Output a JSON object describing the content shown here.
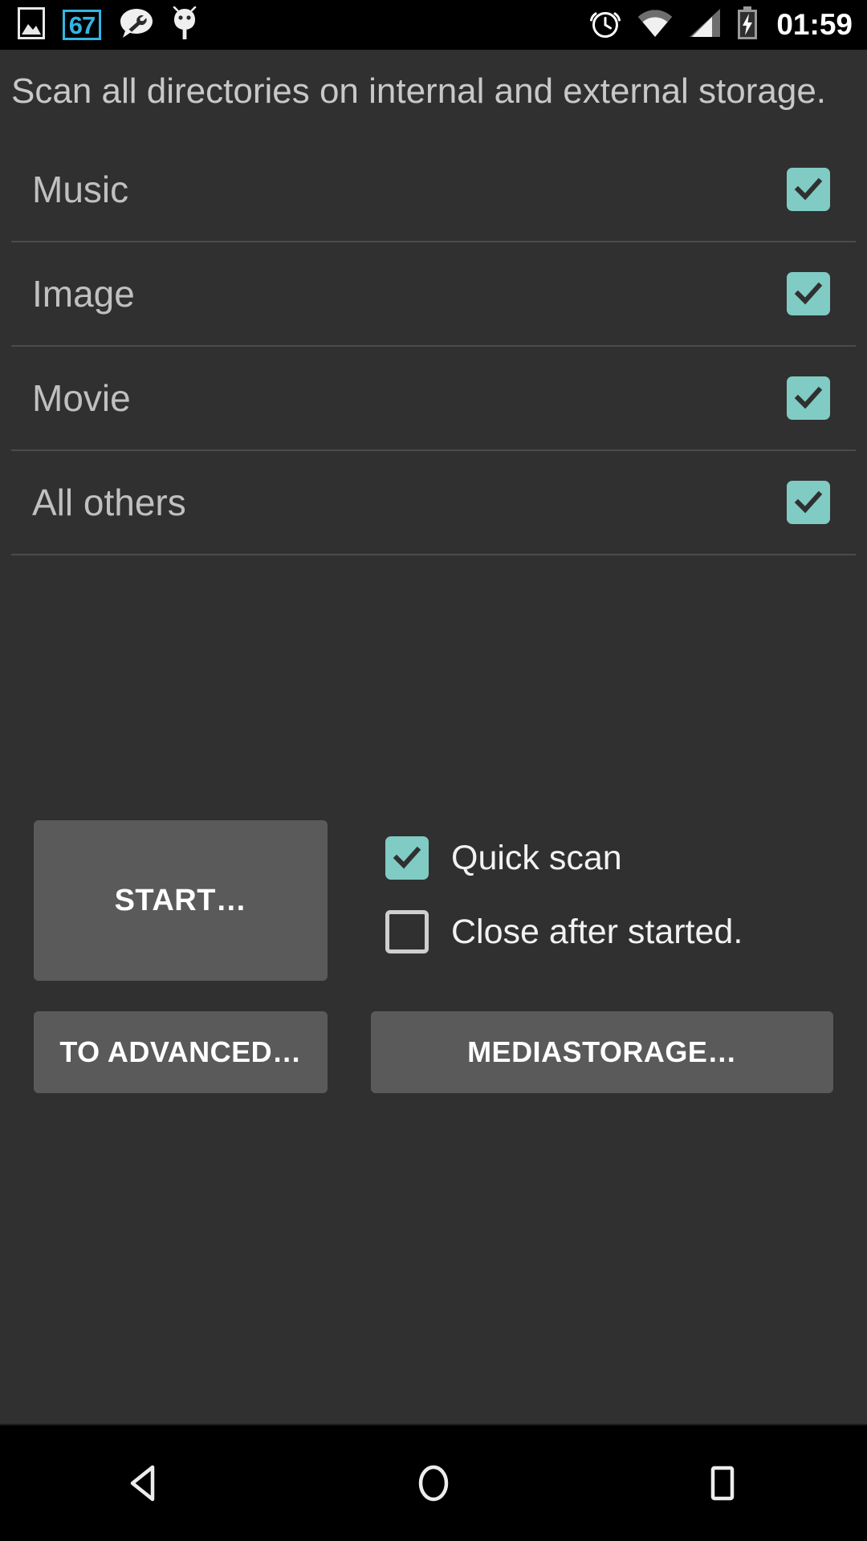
{
  "status_bar": {
    "left_icons": [
      {
        "name": "image-icon",
        "glyph": "image"
      },
      {
        "name": "notification-count-badge",
        "label": "67"
      },
      {
        "name": "chat-wrench-icon",
        "glyph": "chat-wrench"
      },
      {
        "name": "android-debug-icon",
        "glyph": "android-bug"
      }
    ],
    "right_icons": [
      {
        "name": "alarm-clock-icon",
        "glyph": "alarm"
      },
      {
        "name": "wifi-icon",
        "glyph": "wifi"
      },
      {
        "name": "cellular-signal-icon",
        "glyph": "signal"
      },
      {
        "name": "battery-charging-icon",
        "glyph": "battery-charging"
      }
    ],
    "clock": "01:59",
    "badge_color": "#33b5e5",
    "background": "#000000",
    "foreground": "#ffffff"
  },
  "header": {
    "description": "Scan all directories on internal and external storage."
  },
  "categories": [
    {
      "label": "Music",
      "checked": true
    },
    {
      "label": "Image",
      "checked": true
    },
    {
      "label": "Movie",
      "checked": true
    },
    {
      "label": "All others",
      "checked": true
    }
  ],
  "actions": {
    "start_label": "START…",
    "to_advanced_label": "TO ADVANCED…",
    "mediastorage_label": "MEDIASTORAGE…"
  },
  "options": [
    {
      "label": "Quick scan",
      "checked": true
    },
    {
      "label": "Close after started.",
      "checked": false
    }
  ],
  "nav_bar": {
    "buttons": [
      {
        "name": "back-button",
        "glyph": "triangle-left"
      },
      {
        "name": "home-button",
        "glyph": "circle"
      },
      {
        "name": "recents-button",
        "glyph": "square"
      }
    ]
  },
  "colors": {
    "background": "#303030",
    "checkbox_accent": "#80cbc4",
    "button_face": "#5a5a5a",
    "divider": "#4b4b4b",
    "primary_text": "#c8c8c8",
    "button_text": "#ffffff"
  }
}
